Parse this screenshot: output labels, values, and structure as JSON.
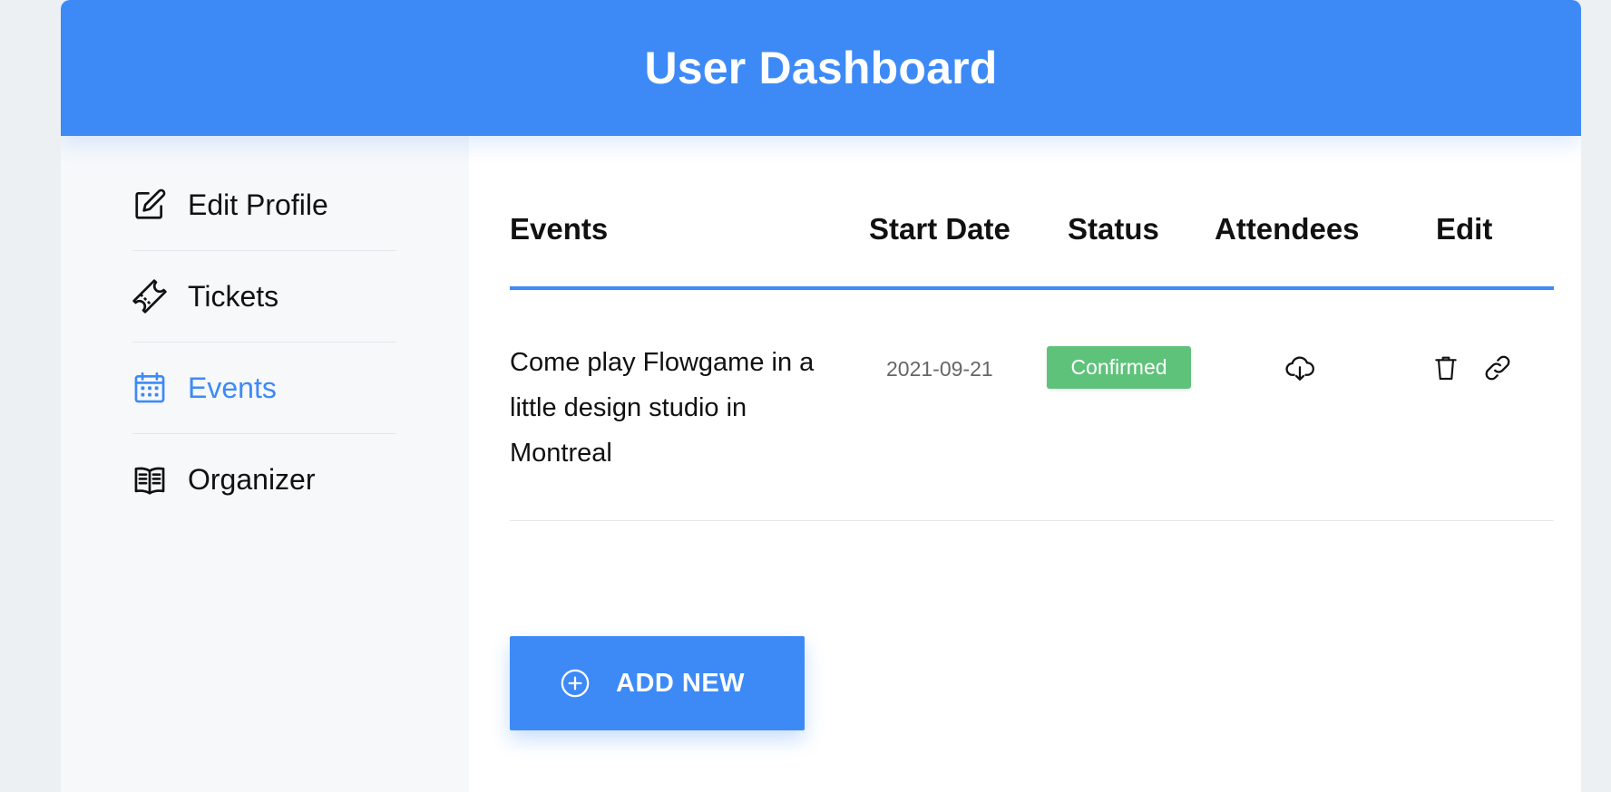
{
  "header": {
    "title": "User Dashboard"
  },
  "sidebar": {
    "items": [
      {
        "label": "Edit Profile",
        "icon": "edit-icon",
        "active": false
      },
      {
        "label": "Tickets",
        "icon": "ticket-icon",
        "active": false
      },
      {
        "label": "Events",
        "icon": "calendar-icon",
        "active": true
      },
      {
        "label": "Organizer",
        "icon": "book-icon",
        "active": false
      }
    ]
  },
  "table": {
    "columns": [
      "Events",
      "Start Date",
      "Status",
      "Attendees",
      "Edit"
    ],
    "rows": [
      {
        "event": "Come play Flowgame in a little design studio in Montreal",
        "start_date": "2021-09-21",
        "status": "Confirmed",
        "attendees_icon": "cloud-download-icon",
        "edit_icons": [
          "trash-icon",
          "link-icon"
        ]
      }
    ]
  },
  "actions": {
    "add_new_label": "ADD NEW",
    "add_new_icon": "plus-circle-icon"
  },
  "colors": {
    "accent": "#3d8af7",
    "status_confirmed": "#5fc27a",
    "sidebar_bg": "#f6f8fa"
  }
}
